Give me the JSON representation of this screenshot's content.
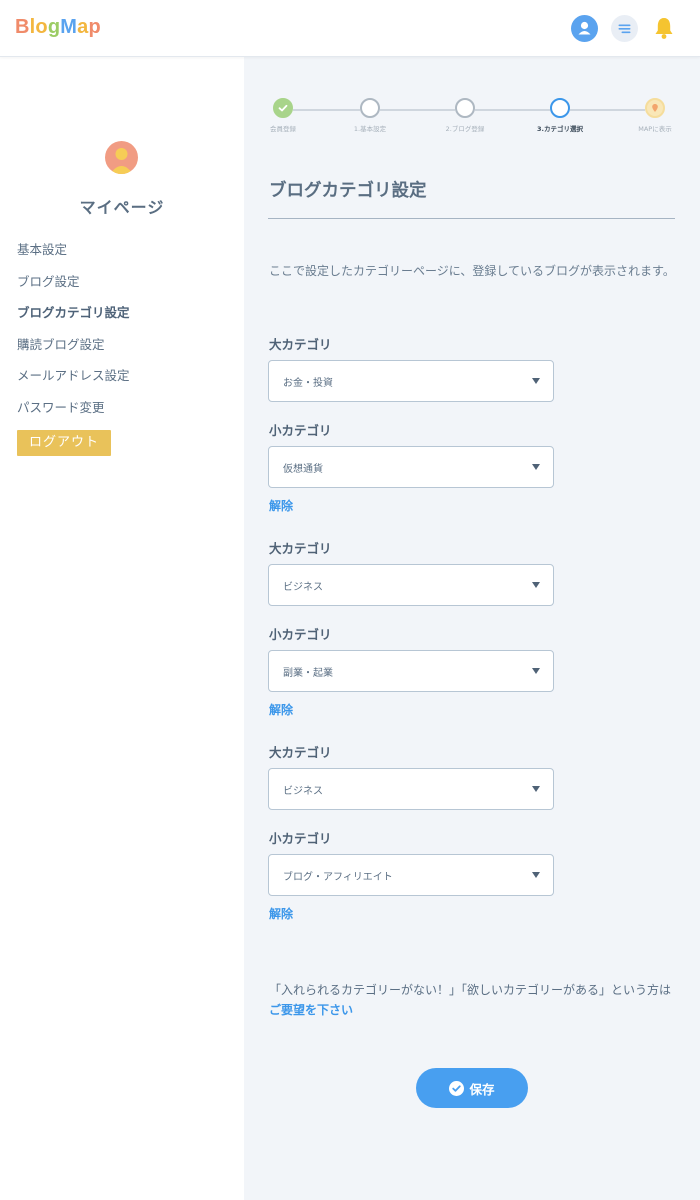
{
  "header": {
    "logo_letters": [
      {
        "char": "B",
        "color": "#f08b6a"
      },
      {
        "char": "l",
        "color": "#f3b63f"
      },
      {
        "char": "o",
        "color": "#f3b63f"
      },
      {
        "char": "g",
        "color": "#9ccc65"
      },
      {
        "char": "M",
        "color": "#5aa3ef"
      },
      {
        "char": "a",
        "color": "#f3b63f"
      },
      {
        "char": "p",
        "color": "#f08b6a"
      }
    ],
    "icons": [
      "user-icon",
      "menu-icon",
      "bell-icon"
    ]
  },
  "sidebar": {
    "title": "マイページ",
    "items": [
      {
        "label": "基本設定",
        "active": false
      },
      {
        "label": "ブログ設定",
        "active": false
      },
      {
        "label": "ブログカテゴリ設定",
        "active": true
      },
      {
        "label": "購読ブログ設定",
        "active": false
      },
      {
        "label": "メールアドレス設定",
        "active": false
      },
      {
        "label": "パスワード変更",
        "active": false
      }
    ],
    "logout_label": "ログアウト"
  },
  "stepper": {
    "steps": [
      {
        "label": "会員登録",
        "state": "done"
      },
      {
        "label": "1.基本設定",
        "state": "pending"
      },
      {
        "label": "2.ブログ登録",
        "state": "pending"
      },
      {
        "label": "3.カテゴリ選択",
        "state": "current"
      },
      {
        "label": "MAPに表示",
        "state": "future"
      }
    ]
  },
  "main": {
    "title": "ブログカテゴリ設定",
    "description": "ここで設定したカテゴリーページに、登録しているブログが表示されます。",
    "groups": [
      {
        "major_label": "大カテゴリ",
        "major_value": "お金・投資",
        "minor_label": "小カテゴリ",
        "minor_value": "仮想通貨",
        "remove_label": "解除"
      },
      {
        "major_label": "大カテゴリ",
        "major_value": "ビジネス",
        "minor_label": "小カテゴリ",
        "minor_value": "副業・起業",
        "remove_label": "解除"
      },
      {
        "major_label": "大カテゴリ",
        "major_value": "ビジネス",
        "minor_label": "小カテゴリ",
        "minor_value": "ブログ・アフィリエイト",
        "remove_label": "解除"
      }
    ],
    "request_text_1": "「入れられるカテゴリーがない！」「欲しいカテゴリーがある」という方は",
    "request_link": "ご要望を下さい",
    "save_label": "保存"
  }
}
